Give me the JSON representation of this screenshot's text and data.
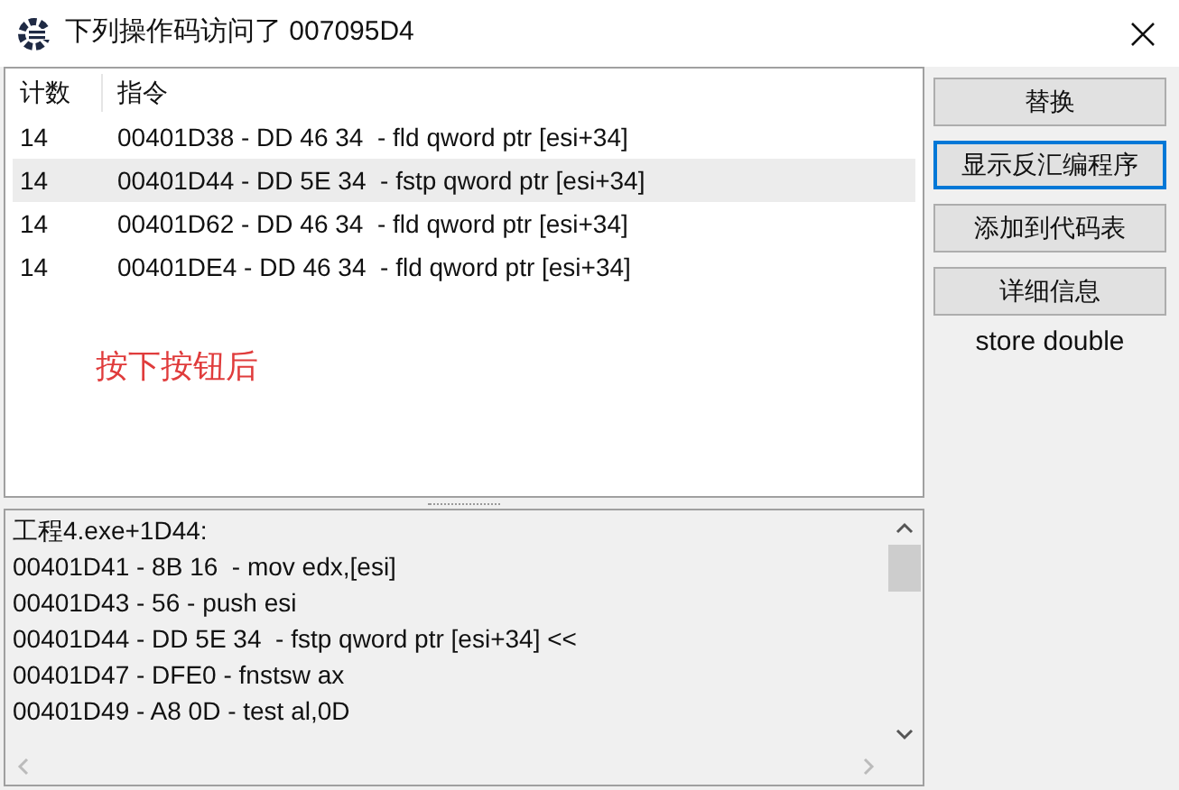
{
  "window": {
    "title": "下列操作码访问了 007095D4"
  },
  "table": {
    "columns": [
      "计数",
      "指令"
    ],
    "rows": [
      {
        "count": "14",
        "instruction": "00401D38 - DD 46 34  - fld qword ptr [esi+34]",
        "selected": false
      },
      {
        "count": "14",
        "instruction": "00401D44 - DD 5E 34  - fstp qword ptr [esi+34]",
        "selected": true
      },
      {
        "count": "14",
        "instruction": "00401D62 - DD 46 34  - fld qword ptr [esi+34]",
        "selected": false
      },
      {
        "count": "14",
        "instruction": "00401DE4 - DD 46 34  - fld qword ptr [esi+34]",
        "selected": false
      }
    ]
  },
  "annotation": "按下按钮后",
  "buttons": [
    {
      "label": "替换",
      "focused": false
    },
    {
      "label": "显示反汇编程序",
      "focused": true
    },
    {
      "label": "添加到代码表",
      "focused": false
    },
    {
      "label": "详细信息",
      "focused": false
    }
  ],
  "description": "store double",
  "disassembly": [
    "工程4.exe+1D44:",
    "00401D41 - 8B 16  - mov edx,[esi]",
    "00401D43 - 56 - push esi",
    "00401D44 - DD 5E 34  - fstp qword ptr [esi+34] <<",
    "00401D47 - DFE0 - fnstsw ax",
    "00401D49 - A8 0D - test al,0D"
  ]
}
